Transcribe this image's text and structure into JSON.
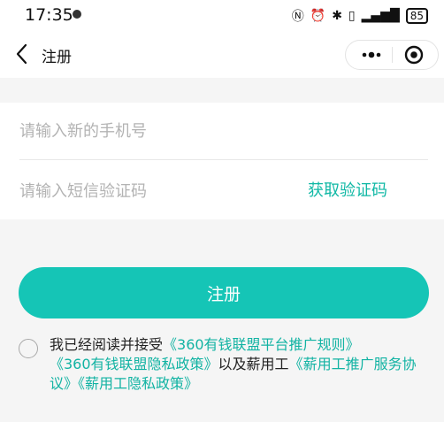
{
  "status_bar": {
    "time": "17:35",
    "battery": "85"
  },
  "nav": {
    "title": "注册"
  },
  "form": {
    "phone_placeholder": "请输入新的手机号",
    "code_placeholder": "请输入短信验证码",
    "get_code_label": "获取验证码"
  },
  "register_label": "注册",
  "agreement": {
    "prefix": "我已经阅读并接受",
    "link1": "《360有钱联盟平台推广规则》",
    "link2": "《360有钱联盟隐私政策》",
    "middle": "以及薪用工",
    "link3": "《薪用工推广服务协议》",
    "link4": "《薪用工隐私政策》"
  },
  "colors": {
    "accent": "#15c5b6",
    "link": "#12b3a3"
  }
}
